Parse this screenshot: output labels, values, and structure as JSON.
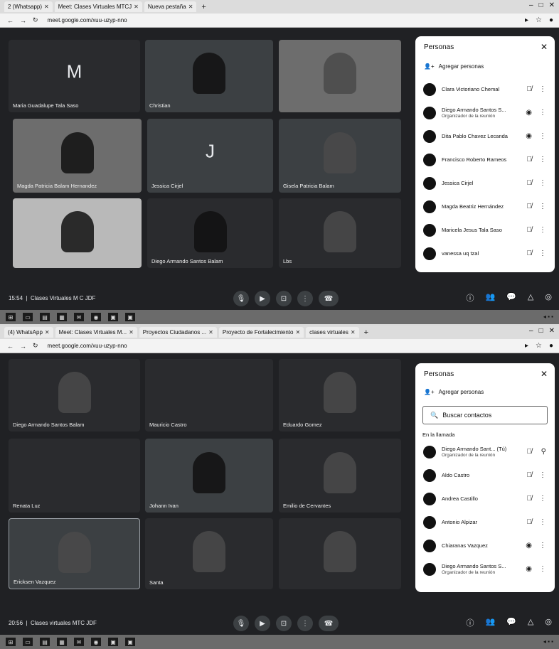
{
  "screens": [
    {
      "tabs": [
        "2 (Whatsapp)",
        "Meet: Clases Virtuales MTCJ",
        "Nueva pestaña"
      ],
      "url": "meet.google.com/xuu-uzyp-nno",
      "tiles": [
        {
          "name": "Maria Guadalupe Tala Saso",
          "initial": "M"
        },
        {
          "name": "Christian",
          "initial": ""
        },
        {
          "name": "",
          "initial": ""
        },
        {
          "name": "Magda Patricia Balam Hernandez",
          "initial": ""
        },
        {
          "name": "Jessica Cirjel",
          "initial": "J"
        },
        {
          "name": "Gisela Patricia Balam",
          "initial": ""
        },
        {
          "name": "",
          "initial": ""
        },
        {
          "name": "Diego Armando Santos Balam",
          "initial": ""
        },
        {
          "name": "Lbs",
          "initial": ""
        }
      ],
      "panel": {
        "title": "Personas",
        "close": "✕",
        "add_people": "Agregar personas",
        "participants": [
          {
            "name": "Clara Victoriano Chemal",
            "sub": ""
          },
          {
            "name": "Diego Armando Santos S...",
            "sub": "Organizador de la reunión"
          },
          {
            "name": "Dita Pablo Chavez Lecanda",
            "sub": ""
          },
          {
            "name": "Francisco Roberto Rameos",
            "sub": ""
          },
          {
            "name": "Jessica Cirjel",
            "sub": ""
          },
          {
            "name": "Magda Beatriz Hernández",
            "sub": ""
          },
          {
            "name": "Maricela Jesus Tala Saso",
            "sub": ""
          },
          {
            "name": "vanessa uq tzal",
            "sub": ""
          }
        ]
      },
      "bottom": {
        "time": "15:54",
        "meeting": "Clases Virtuales M C JDF"
      }
    },
    {
      "tabs": [
        "(4) WhatsApp",
        "Meet: Clases Virtuales M...",
        "Proyectos Ciudadanos ...",
        "Proyecto de Fortalecimiento",
        "clases virtuales"
      ],
      "url": "meet.google.com/xuu-uzyp-nno",
      "tiles": [
        {
          "name": "Diego Armando Santos Balam",
          "initial": ""
        },
        {
          "name": "Mauricio Castro",
          "initial": ""
        },
        {
          "name": "Eduardo Gomez",
          "initial": ""
        },
        {
          "name": "Renata Luz",
          "initial": ""
        },
        {
          "name": "Johann Ivan",
          "initial": ""
        },
        {
          "name": "Emilio de Cervantes",
          "initial": ""
        },
        {
          "name": "Ericksen Vazquez",
          "initial": ""
        },
        {
          "name": "Santa",
          "initial": ""
        },
        {
          "name": "",
          "initial": ""
        }
      ],
      "panel": {
        "title": "Personas",
        "close": "✕",
        "add_people": "Agregar personas",
        "search_placeholder": "Buscar contactos",
        "section": "En la llamada",
        "participants": [
          {
            "name": "Diego Armando Sant... (Tú)",
            "sub": "Organizador de la reunión"
          },
          {
            "name": "Aldo Castro",
            "sub": ""
          },
          {
            "name": "Andrea Castillo",
            "sub": ""
          },
          {
            "name": "Antonio Alpizar",
            "sub": ""
          },
          {
            "name": "Chiaranas Vazquez",
            "sub": ""
          },
          {
            "name": "Diego Armando Santos S...",
            "sub": "Organizador de la reunión"
          }
        ]
      },
      "bottom": {
        "time": "20:56",
        "meeting": "Clases virtuales MTC JDF"
      }
    }
  ],
  "icons": {
    "mic_off": "mic-off-icon",
    "more": "more-vertical-icon",
    "add": "add-person-icon",
    "search": "search-icon"
  },
  "colors": {
    "meet_bg": "#202124",
    "panel_bg": "#ffffff",
    "tile_bg": "#3c4043"
  }
}
